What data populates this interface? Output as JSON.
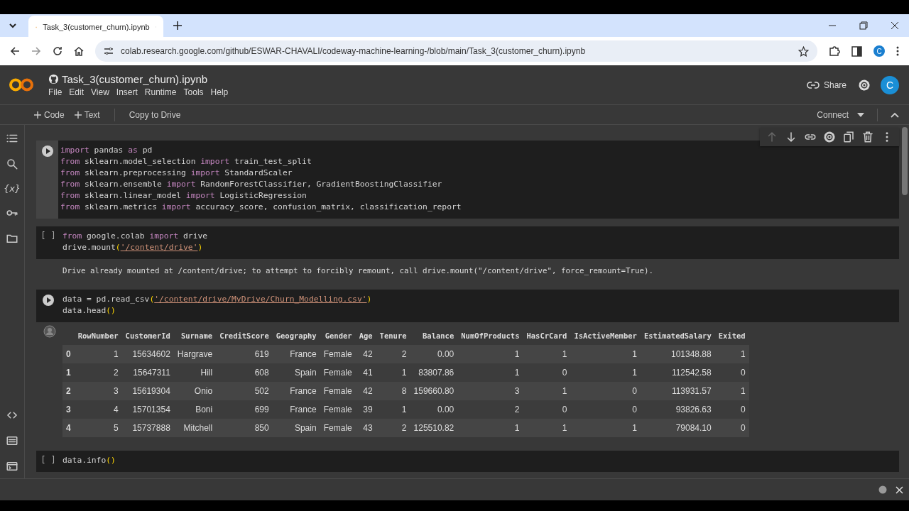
{
  "browser": {
    "tab_title": "Task_3(customer_churn).ipynb",
    "url": "colab.research.google.com/github/ESWAR-CHAVALI/codeway-machine-learning-/blob/main/Task_3(customer_churn).ipynb",
    "profile": "C"
  },
  "header": {
    "title": "Task_3(customer_churn).ipynb",
    "menu": [
      "File",
      "Edit",
      "View",
      "Insert",
      "Runtime",
      "Tools",
      "Help"
    ],
    "share": "Share",
    "avatar": "C"
  },
  "toolbar": {
    "add": [
      "Code",
      "Text"
    ],
    "copy": "Copy to Drive",
    "connect": "Connect"
  },
  "sidebar": {
    "variables_glyph": "{x}"
  },
  "cell_toolbar": [
    {
      "disabled": true
    },
    {
      "disabled": false
    },
    {
      "disabled": false
    },
    {
      "disabled": false
    },
    {
      "disabled": false
    },
    {
      "disabled": false
    },
    {
      "disabled": false
    }
  ],
  "cells": [
    {
      "selected": true,
      "prompt": {
        "kind": "run"
      },
      "lines": [
        [
          {
            "kind": "kw",
            "text": "import"
          },
          {
            "kind": "plain",
            "text": " pandas "
          },
          {
            "kind": "kw",
            "text": "as"
          },
          {
            "kind": "plain",
            "text": " pd"
          }
        ],
        [
          {
            "kind": "kw",
            "text": "from"
          },
          {
            "kind": "plain",
            "text": " sklearn.model_selection "
          },
          {
            "kind": "kw",
            "text": "import"
          },
          {
            "kind": "plain",
            "text": " train_test_split"
          }
        ],
        [
          {
            "kind": "kw",
            "text": "from"
          },
          {
            "kind": "plain",
            "text": " sklearn.preprocessing "
          },
          {
            "kind": "kw",
            "text": "import"
          },
          {
            "kind": "plain",
            "text": " StandardScaler"
          }
        ],
        [
          {
            "kind": "kw",
            "text": "from"
          },
          {
            "kind": "plain",
            "text": " sklearn.ensemble "
          },
          {
            "kind": "kw",
            "text": "import"
          },
          {
            "kind": "plain",
            "text": " RandomForestClassifier, GradientBoostingClassifier"
          }
        ],
        [
          {
            "kind": "kw",
            "text": "from"
          },
          {
            "kind": "plain",
            "text": " sklearn.linear_model "
          },
          {
            "kind": "kw",
            "text": "import"
          },
          {
            "kind": "plain",
            "text": " LogisticRegression"
          }
        ],
        [
          {
            "kind": "kw",
            "text": "from"
          },
          {
            "kind": "plain",
            "text": " sklearn.metrics "
          },
          {
            "kind": "kw",
            "text": "import"
          },
          {
            "kind": "plain",
            "text": " accuracy_score, confusion_matrix, classification_report"
          }
        ]
      ]
    },
    {
      "selected": false,
      "prompt": {
        "kind": "brackets",
        "text": "[ ]"
      },
      "lines": [
        [
          {
            "kind": "kw",
            "text": "from"
          },
          {
            "kind": "plain",
            "text": " google.colab "
          },
          {
            "kind": "kw",
            "text": "import"
          },
          {
            "kind": "plain",
            "text": " drive"
          }
        ],
        [
          {
            "kind": "plain",
            "text": "drive.mount"
          },
          {
            "kind": "paren",
            "text": "("
          },
          {
            "kind": "str",
            "text": "'/content/drive'"
          },
          {
            "kind": "paren",
            "text": ")"
          }
        ]
      ],
      "output": {
        "kind": "text",
        "text": "Drive already mounted at /content/drive; to attempt to forcibly remount, call drive.mount(\"/content/drive\", force_remount=True)."
      }
    },
    {
      "selected": false,
      "prompt": {
        "kind": "run"
      },
      "lines": [
        [
          {
            "kind": "plain",
            "text": "data = pd.read_csv"
          },
          {
            "kind": "paren",
            "text": "("
          },
          {
            "kind": "str",
            "text": "'/content/drive/MyDrive/Churn_Modelling.csv'"
          },
          {
            "kind": "paren",
            "text": ")"
          }
        ],
        [
          {
            "kind": "plain",
            "text": "data.head"
          },
          {
            "kind": "paren",
            "text": "()"
          }
        ]
      ],
      "output": {
        "kind": "table",
        "columns": [
          "RowNumber",
          "CustomerId",
          "Surname",
          "CreditScore",
          "Geography",
          "Gender",
          "Age",
          "Tenure",
          "Balance",
          "NumOfProducts",
          "HasCrCard",
          "IsActiveMember",
          "EstimatedSalary",
          "Exited"
        ],
        "rows": [
          {
            "index": "0",
            "cells": [
              "1",
              "15634602",
              "Hargrave",
              "619",
              "France",
              "Female",
              "42",
              "2",
              "0.00",
              "1",
              "1",
              "1",
              "101348.88",
              "1"
            ]
          },
          {
            "index": "1",
            "cells": [
              "2",
              "15647311",
              "Hill",
              "608",
              "Spain",
              "Female",
              "41",
              "1",
              "83807.86",
              "1",
              "0",
              "1",
              "112542.58",
              "0"
            ]
          },
          {
            "index": "2",
            "cells": [
              "3",
              "15619304",
              "Onio",
              "502",
              "France",
              "Female",
              "42",
              "8",
              "159660.80",
              "3",
              "1",
              "0",
              "113931.57",
              "1"
            ]
          },
          {
            "index": "3",
            "cells": [
              "4",
              "15701354",
              "Boni",
              "699",
              "France",
              "Female",
              "39",
              "1",
              "0.00",
              "2",
              "0",
              "0",
              "93826.63",
              "0"
            ]
          },
          {
            "index": "4",
            "cells": [
              "5",
              "15737888",
              "Mitchell",
              "850",
              "Spain",
              "Female",
              "43",
              "2",
              "125510.82",
              "1",
              "1",
              "1",
              "79084.10",
              "0"
            ]
          }
        ]
      }
    },
    {
      "selected": false,
      "prompt": {
        "kind": "brackets",
        "text": "[ ]"
      },
      "lines": [
        [
          {
            "kind": "plain",
            "text": "data.info"
          },
          {
            "kind": "paren",
            "text": "()"
          }
        ]
      ]
    }
  ]
}
